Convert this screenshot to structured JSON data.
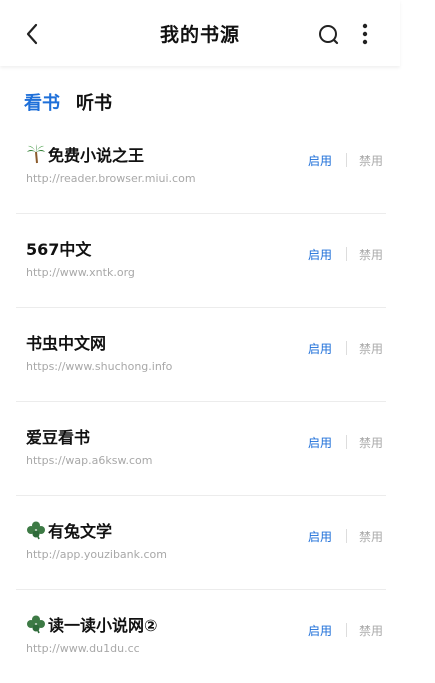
{
  "header": {
    "title": "我的书源",
    "back_icon": "back-arrow-icon",
    "search_icon": "search-icon",
    "more_icon": "more-vertical-icon"
  },
  "tabs": [
    {
      "label": "看书",
      "active": true
    },
    {
      "label": "听书",
      "active": false
    }
  ],
  "colors": {
    "accent": "#1e6fd9",
    "muted": "#aaaaaa",
    "url": "#a8a8a8",
    "palm": "#2f7d32",
    "clover": "#3d7a45"
  },
  "sources": [
    {
      "icon": "palm-tree-icon",
      "name": "免费小说之王",
      "url": "http://reader.browser.miui.com",
      "enable_label": "启用",
      "disable_label": "禁用"
    },
    {
      "icon": "",
      "name": "567中文",
      "url": "http://www.xntk.org",
      "enable_label": "启用",
      "disable_label": "禁用"
    },
    {
      "icon": "",
      "name": "书虫中文网",
      "url": "https://www.shuchong.info",
      "enable_label": "启用",
      "disable_label": "禁用"
    },
    {
      "icon": "",
      "name": "爱豆看书",
      "url": "https://wap.a6ksw.com",
      "enable_label": "启用",
      "disable_label": "禁用"
    },
    {
      "icon": "clover-icon",
      "name": "有兔文学",
      "url": "http://app.youzibank.com",
      "enable_label": "启用",
      "disable_label": "禁用"
    },
    {
      "icon": "clover-icon",
      "name": "读一读小说网②",
      "url": "http://www.du1du.cc",
      "enable_label": "启用",
      "disable_label": "禁用"
    }
  ]
}
